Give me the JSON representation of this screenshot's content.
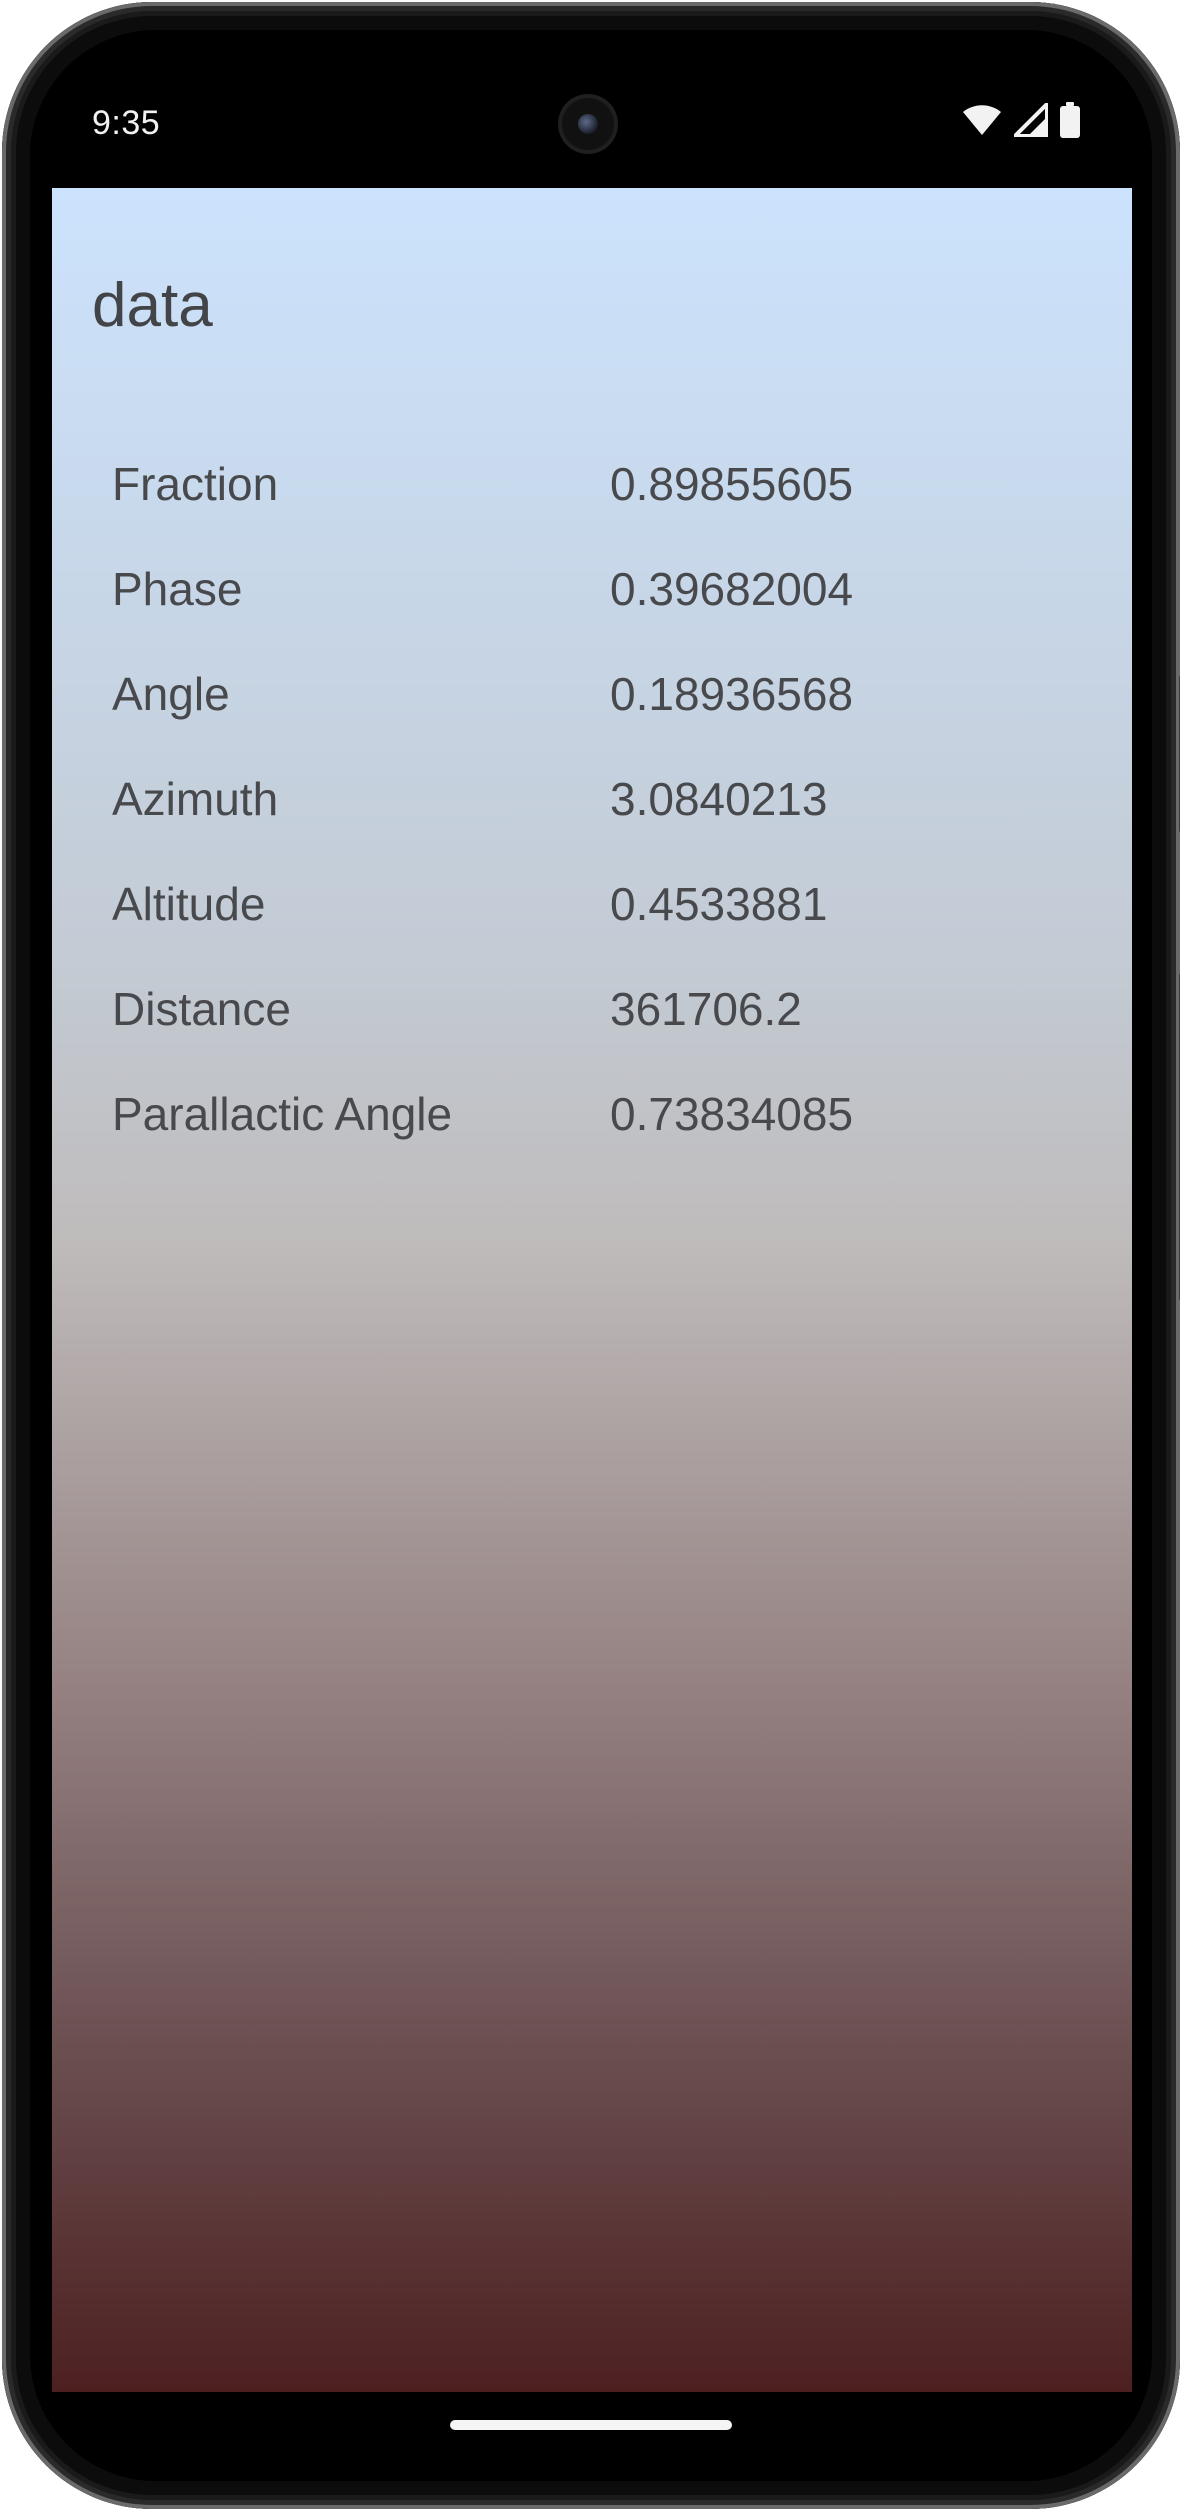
{
  "status_bar": {
    "time": "9:35",
    "icons": [
      "wifi-icon",
      "cellular-signal-icon",
      "battery-icon"
    ]
  },
  "app": {
    "title": "data",
    "rows": [
      {
        "label": "Fraction",
        "value": "0.89855605"
      },
      {
        "label": "Phase",
        "value": "0.39682004"
      },
      {
        "label": "Angle",
        "value": "0.18936568"
      },
      {
        "label": "Azimuth",
        "value": "3.0840213"
      },
      {
        "label": "Altitude",
        "value": "0.4533881"
      },
      {
        "label": "Distance",
        "value": "361706.2"
      },
      {
        "label": "Parallactic Angle",
        "value": "0.73834085"
      }
    ]
  },
  "colors": {
    "gradient_top": "#cce3fd",
    "gradient_bottom": "#4d2020",
    "text": "#48494c"
  }
}
